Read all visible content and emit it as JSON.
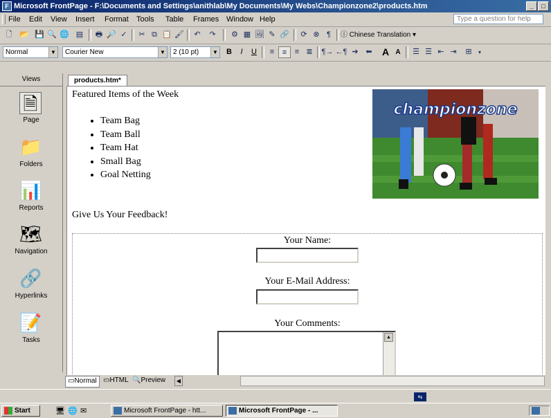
{
  "window": {
    "title": "Microsoft FrontPage - F:\\Documents and Settings\\anithlab\\My Documents\\My Webs\\Championzone2\\products.htm"
  },
  "menubar": {
    "items": [
      "File",
      "Edit",
      "View",
      "Insert",
      "Format",
      "Tools",
      "Table",
      "Frames",
      "Window",
      "Help"
    ],
    "ask_placeholder": "Type a question for help"
  },
  "toolbar_standard": {
    "translation_label": "Chinese Translation"
  },
  "toolbar_format": {
    "style": "Normal",
    "font": "Courier New",
    "size": "2 (10 pt)"
  },
  "views": {
    "header": "Views",
    "items": [
      {
        "label": "Page",
        "icon": "page-icon"
      },
      {
        "label": "Folders",
        "icon": "folder-icon"
      },
      {
        "label": "Reports",
        "icon": "reports-icon"
      },
      {
        "label": "Navigation",
        "icon": "navigation-icon"
      },
      {
        "label": "Hyperlinks",
        "icon": "hyperlinks-icon"
      },
      {
        "label": "Tasks",
        "icon": "tasks-icon"
      }
    ]
  },
  "editor": {
    "tab": "products.htm*",
    "heading": "Featured Items of the Week",
    "items": [
      "Team Bag",
      "Team Ball",
      "Team Hat",
      "Small Bag",
      "Goal Netting"
    ],
    "logo_text": "championzone",
    "feedback_heading": "Give Us Your Feedback!",
    "form": {
      "name_label": "Your Name:",
      "email_label": "Your E-Mail Address:",
      "comments_label": "Your Comments:"
    }
  },
  "view_tabs": [
    "Normal",
    "HTML",
    "Preview"
  ],
  "taskbar": {
    "start": "Start",
    "tasks": [
      "Microsoft FrontPage - htt...",
      "Microsoft FrontPage - ..."
    ]
  }
}
